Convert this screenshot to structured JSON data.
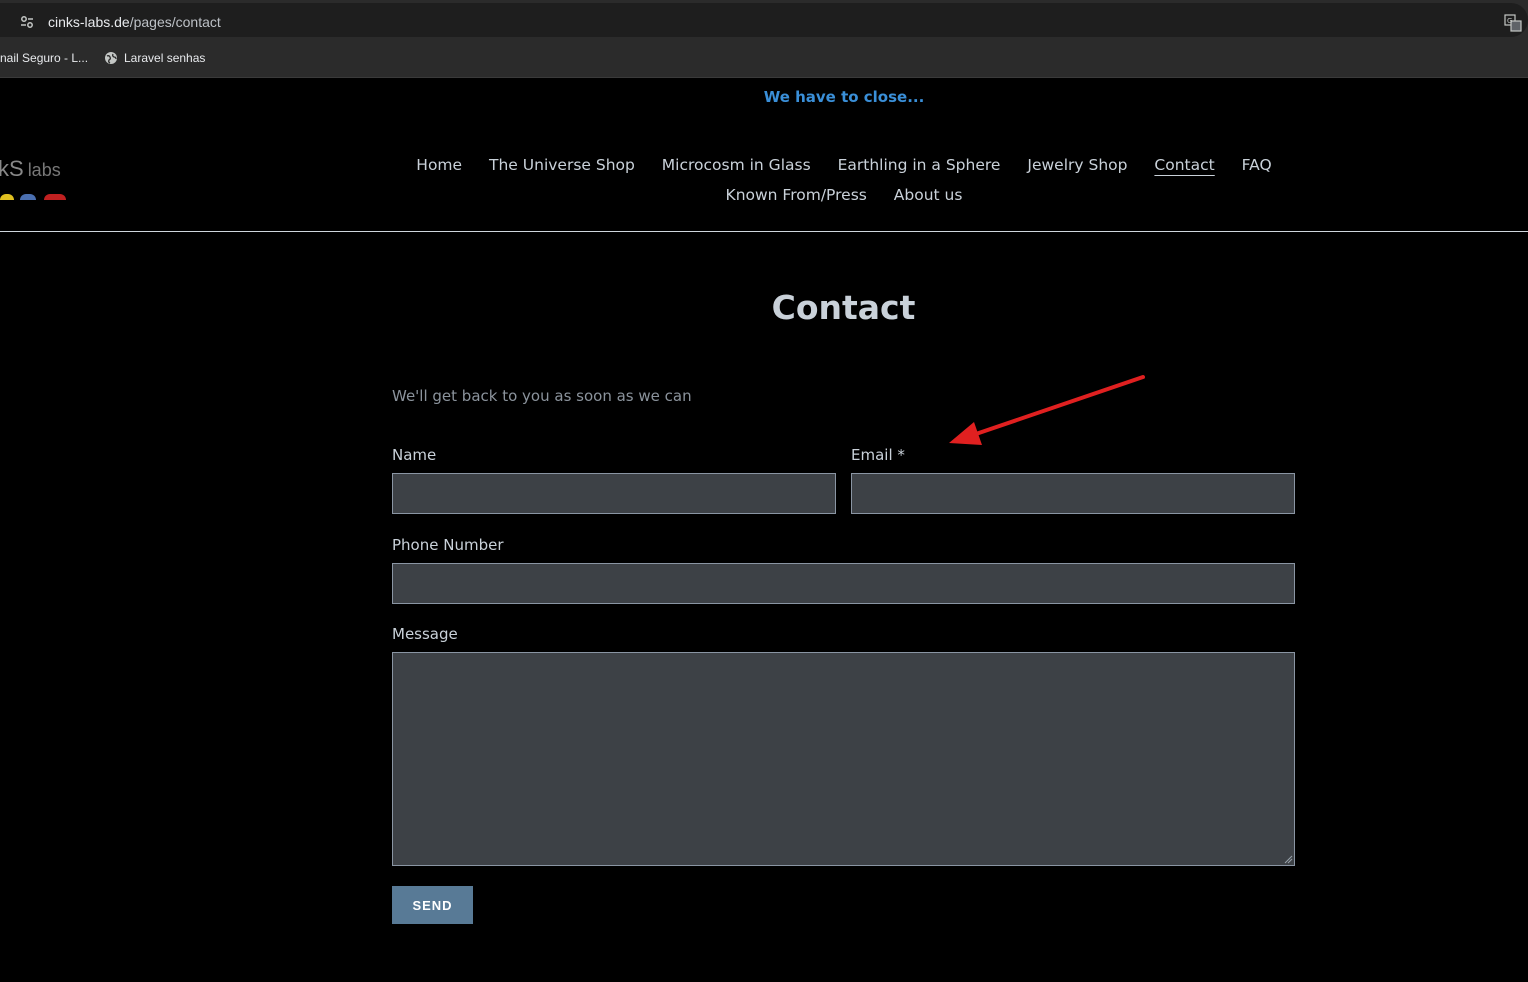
{
  "browser": {
    "url_host": "cinks-labs.de",
    "url_path": "/pages/contact",
    "bookmarks": [
      "nail Seguro - L...",
      "Laravel senhas"
    ]
  },
  "site": {
    "announcement": "We have to close...",
    "logo": {
      "text": "kS",
      "suffix": "labs"
    },
    "nav": [
      {
        "label": "Home"
      },
      {
        "label": "The Universe Shop"
      },
      {
        "label": "Microcosm in Glass"
      },
      {
        "label": "Earthling in a Sphere"
      },
      {
        "label": "Jewelry Shop"
      },
      {
        "label": "Contact",
        "active": true
      },
      {
        "label": "FAQ"
      },
      {
        "label": "Known From/Press"
      },
      {
        "label": "About us"
      }
    ]
  },
  "page": {
    "title": "Contact",
    "subtitle": "We'll get back to you as soon as we can"
  },
  "form": {
    "name_label": "Name",
    "email_label": "Email *",
    "phone_label": "Phone Number",
    "message_label": "Message",
    "send_label": "SEND"
  },
  "colors": {
    "accent": "#3a8fd8",
    "button": "#587a96",
    "field_bg": "#3d4146",
    "arrow": "#e02020"
  }
}
